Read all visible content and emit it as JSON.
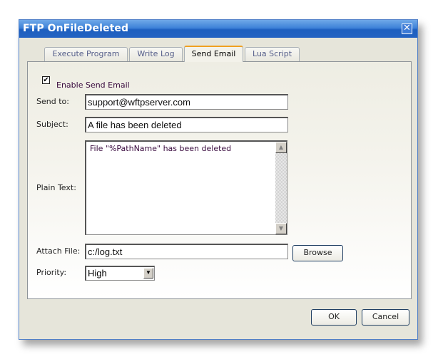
{
  "window": {
    "title": "FTP OnFileDeleted",
    "close_glyph": "✕"
  },
  "tabs": [
    {
      "label": "Execute Program",
      "active": false
    },
    {
      "label": "Write Log",
      "active": false
    },
    {
      "label": "Send Email",
      "active": true
    },
    {
      "label": "Lua Script",
      "active": false
    }
  ],
  "form": {
    "enable": {
      "label": "Enable Send Email",
      "checked": true,
      "glyph": "✔"
    },
    "send_to": {
      "label": "Send to:",
      "value": "support@wftpserver.com"
    },
    "subject": {
      "label": "Subject:",
      "value": "A file has been deleted"
    },
    "plain_text": {
      "label": "Plain Text:",
      "value": "File \"%PathName\" has been deleted"
    },
    "attach_file": {
      "label": "Attach File:",
      "value": "c:/log.txt",
      "browse_label": "Browse"
    },
    "priority": {
      "label": "Priority:",
      "value": "High",
      "arrow_glyph": "▼"
    }
  },
  "scrollbar": {
    "up_glyph": "▲",
    "down_glyph": "▼"
  },
  "footer": {
    "ok_label": "OK",
    "cancel_label": "Cancel"
  }
}
